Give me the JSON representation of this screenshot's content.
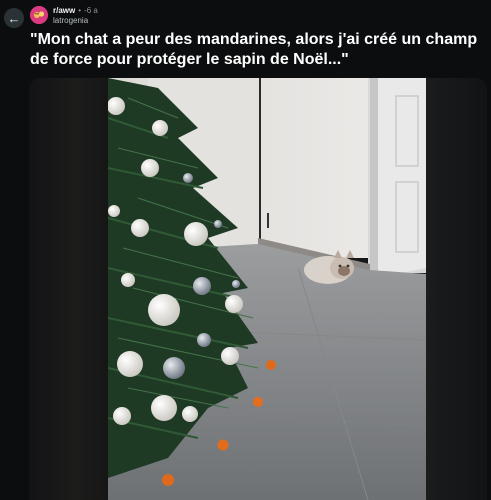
{
  "header": {
    "back_icon": "arrow-left-icon",
    "subreddit": "r/aww",
    "separator": "•",
    "age": "-6 a",
    "author": "latrogenia",
    "avatar_icon": "subreddit-avatar-icon"
  },
  "post": {
    "title": "\"Mon chat a peur des mandarines, alors j'ai créé un champ de force pour protéger le sapin de Noël...\""
  },
  "colors": {
    "background": "#0b0d0f",
    "back_button": "#2a3236",
    "avatar": "#d93a80"
  }
}
